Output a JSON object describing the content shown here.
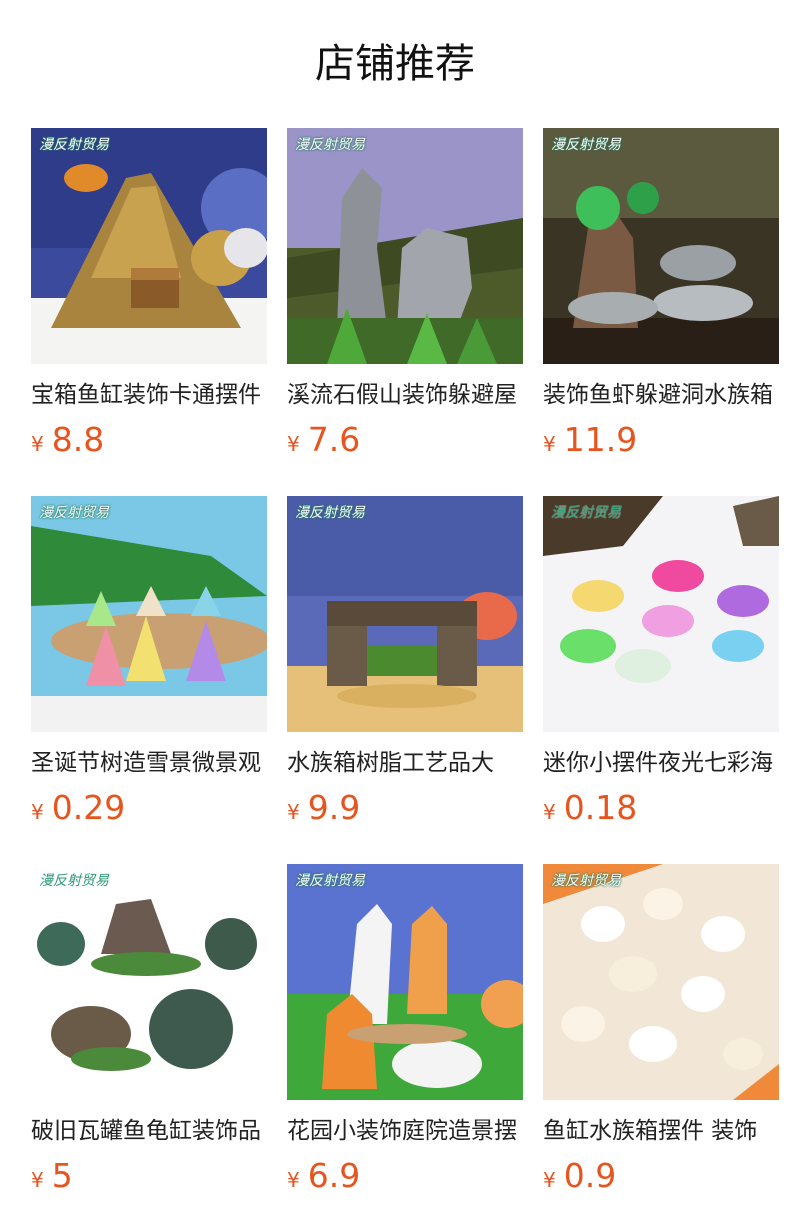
{
  "page": {
    "title": "店铺推荐"
  },
  "products": [
    {
      "name": "宝箱鱼缸装饰卡通摆件",
      "currency": "¥",
      "price": "8.8",
      "watermark": "漫反射贸易"
    },
    {
      "name": "溪流石假山装饰躲避屋",
      "currency": "¥",
      "price": "7.6",
      "watermark": "漫反射贸易"
    },
    {
      "name": "装饰鱼虾躲避洞水族箱",
      "currency": "¥",
      "price": "11.9",
      "watermark": "漫反射贸易"
    },
    {
      "name": "圣诞节树造雪景微景观",
      "currency": "¥",
      "price": "0.29",
      "watermark": "漫反射贸易"
    },
    {
      "name": "水族箱树脂工艺品大",
      "currency": "¥",
      "price": "9.9",
      "watermark": "漫反射贸易"
    },
    {
      "name": "迷你小摆件夜光七彩海",
      "currency": "¥",
      "price": "0.18",
      "watermark": "漫反射贸易"
    },
    {
      "name": "破旧瓦罐鱼龟缸装饰品",
      "currency": "¥",
      "price": "5",
      "watermark": "漫反射贸易"
    },
    {
      "name": "花园小装饰庭院造景摆",
      "currency": "¥",
      "price": "6.9",
      "watermark": "漫反射贸易"
    },
    {
      "name": "鱼缸水族箱摆件 装饰",
      "currency": "¥",
      "price": "0.9",
      "watermark": "漫反射贸易"
    }
  ],
  "colors": {
    "price": "#e8541e"
  }
}
